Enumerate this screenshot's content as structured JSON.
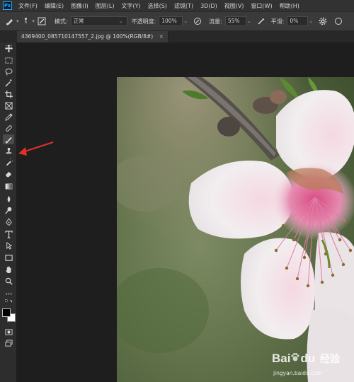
{
  "menubar": {
    "logo_text": "Ps",
    "items": [
      "文件(F)",
      "编辑(E)",
      "图像(I)",
      "图层(L)",
      "文字(Y)",
      "选择(S)",
      "滤镜(T)",
      "3D(D)",
      "视图(V)",
      "窗口(W)",
      "帮助(H)"
    ]
  },
  "options": {
    "brush_size": "5",
    "mode_label": "模式:",
    "mode_value": "正常",
    "opacity_label": "不透明度:",
    "opacity_value": "100%",
    "flow_label": "流量:",
    "flow_value": "55%",
    "smoothing_label": "平滑:",
    "smoothing_value": "0%"
  },
  "document": {
    "tab_title": "4369400_085710147557_2.jpg @ 100%(RGB/8#)",
    "close_glyph": "×"
  },
  "watermark": {
    "brand": "Bai",
    "brand2": "du",
    "cn": "经验",
    "url": "jingyan.baidu.com"
  },
  "colors": {
    "arrow": "#e0302a",
    "accent": "#2fa3f7"
  }
}
